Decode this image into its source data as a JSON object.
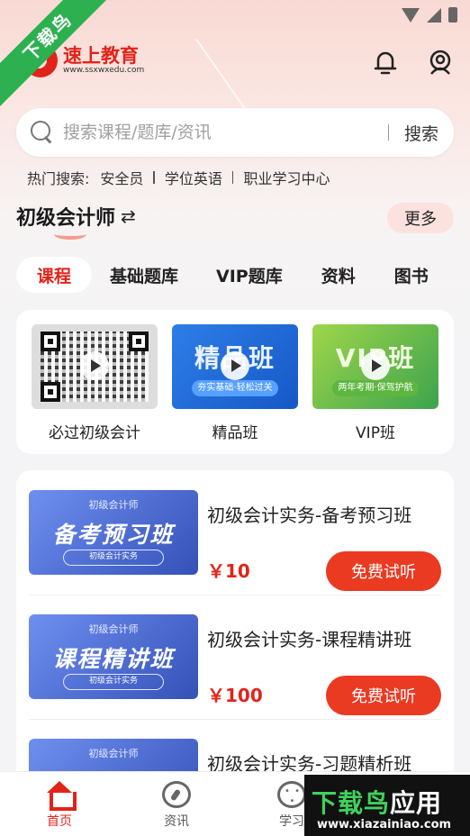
{
  "watermark": {
    "ribbon": "下载鸟",
    "title_green": "下载鸟",
    "title_white": "应用",
    "url": "www.xiazainiao.com"
  },
  "brand": {
    "name": "速上教育",
    "url": "www.ssxwxedu.com"
  },
  "search": {
    "placeholder": "搜索课程/题库/资讯",
    "button": "搜索"
  },
  "hot_search": {
    "label": "热门搜索:",
    "items": [
      "安全员",
      "学位英语",
      "职业学习中心"
    ]
  },
  "exam": {
    "title": "初级会计师",
    "switch_icon": "⇄",
    "more": "更多"
  },
  "tabs": [
    "课程",
    "基础题库",
    "VIP题库",
    "资料",
    "图书"
  ],
  "promos": [
    {
      "label": "必过初级会计"
    },
    {
      "label": "精品班",
      "banner": "精品班",
      "banner_sub": "夯实基础·轻松过关"
    },
    {
      "label": "VIP班",
      "banner": "VIP班",
      "banner_sub": "两年考期·保驾护航"
    }
  ],
  "courses": [
    {
      "title": "初级会计实务-备考预习班",
      "price": "￥10",
      "thumb_tag": "初级会计师",
      "thumb_big": "备考预习班",
      "thumb_pill": "初级会计实务",
      "button": "免费试听"
    },
    {
      "title": "初级会计实务-课程精讲班",
      "price": "￥100",
      "thumb_tag": "初级会计师",
      "thumb_big": "课程精讲班",
      "thumb_pill": "初级会计实务",
      "button": "免费试听"
    },
    {
      "title": "初级会计实务-习题精析班",
      "thumb_tag": "初级会计师"
    }
  ],
  "tabbar": [
    {
      "label": "首页",
      "icon": "home-icon"
    },
    {
      "label": "资讯",
      "icon": "compass-icon"
    },
    {
      "label": "学习",
      "icon": "chat-icon"
    }
  ],
  "colors": {
    "accent": "#e2231a",
    "button": "#ea3a22",
    "ribbon": "#2db050"
  }
}
